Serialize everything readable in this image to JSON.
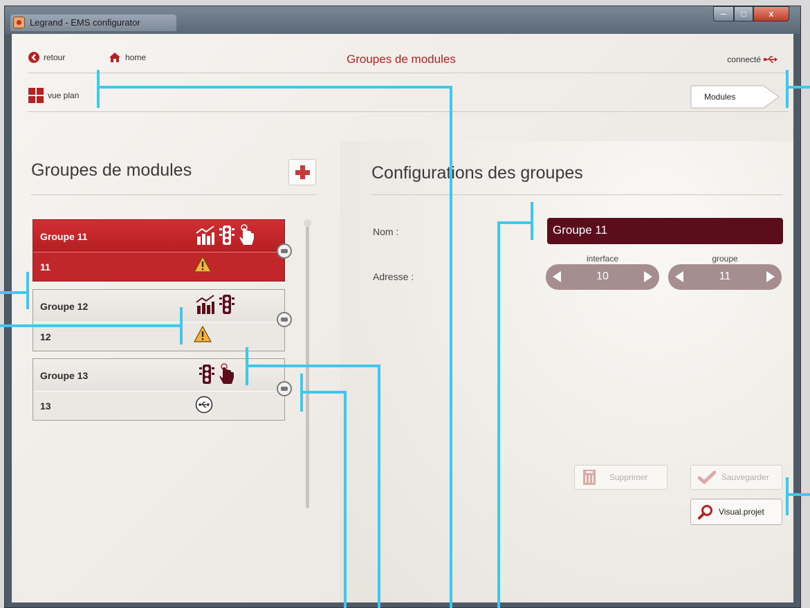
{
  "window": {
    "title": "Legrand - EMS configurator",
    "close_glyph": "x"
  },
  "nav": {
    "back_label": "retour",
    "home_label": "home",
    "page_title": "Groupes de modules",
    "status_label": "connecté",
    "plan_view_label": "vue plan",
    "modules_label": "Modules"
  },
  "left_panel": {
    "title": "Groupes de modules",
    "groups": [
      {
        "name": "Groupe  11",
        "address": "11",
        "selected": true,
        "icons": [
          "chart-icon",
          "traffic-light-icon",
          "hand-pointer-icon"
        ],
        "status_icon": "warning-icon"
      },
      {
        "name": "Groupe  12",
        "address": "12",
        "selected": false,
        "icons": [
          "chart-icon",
          "traffic-light-icon"
        ],
        "status_icon": "warning-icon"
      },
      {
        "name": "Groupe  13",
        "address": "13",
        "selected": false,
        "icons": [
          "traffic-light-icon",
          "hand-pointer-icon"
        ],
        "status_icon": "usb-icon"
      }
    ]
  },
  "right_panel": {
    "title": "Configurations des groupes",
    "name_label": "Nom :",
    "name_value": "Groupe  11",
    "address_label": "Adresse :",
    "interface_label": "interface",
    "interface_value": "10",
    "group_label": "groupe",
    "group_value": "11",
    "visual_project_label": "Visual.projet",
    "delete_label": "Supprimer",
    "save_label": "Sauvegarder"
  },
  "colors": {
    "accent_red": "#b52222",
    "selected_group": "#c0262a",
    "name_field": "#5c0d1b",
    "stepper": "#a68d8f",
    "callout": "#3ec7ef"
  }
}
